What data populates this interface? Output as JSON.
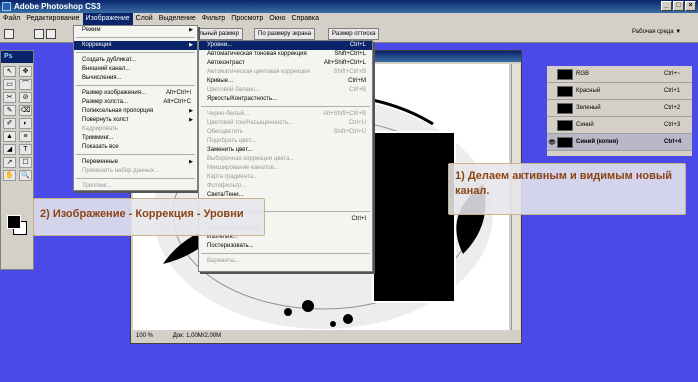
{
  "app": {
    "title": "Adobe Photoshop CS3"
  },
  "menubar": [
    "Файл",
    "Редактирование",
    "Изображение",
    "Слой",
    "Выделение",
    "Фильтр",
    "Просмотр",
    "Окно",
    "Справка"
  ],
  "options_bar": {
    "btn1": "Реальный размер",
    "btn2": "По размеру экрана",
    "btn3": "Размер оттиска",
    "workspace": "Рабочая среда"
  },
  "image_menu": [
    {
      "label": "Режим",
      "arrow": true
    },
    {
      "sep": true
    },
    {
      "label": "Коррекция",
      "arrow": true,
      "highlight": true
    },
    {
      "sep": true
    },
    {
      "label": "Создать дубликат..."
    },
    {
      "label": "Внешний канал..."
    },
    {
      "label": "Вычисления..."
    },
    {
      "sep": true
    },
    {
      "label": "Размер изображения...",
      "shortcut": "Alt+Ctrl+I"
    },
    {
      "label": "Размер холста...",
      "shortcut": "Alt+Ctrl+C"
    },
    {
      "label": "Попиксельная пропорция",
      "arrow": true
    },
    {
      "label": "Повернуть холст",
      "arrow": true
    },
    {
      "label": "Кадрировать",
      "disabled": true
    },
    {
      "label": "Тримминг..."
    },
    {
      "label": "Показать все"
    },
    {
      "sep": true
    },
    {
      "label": "Переменные",
      "arrow": true
    },
    {
      "label": "Применить набор данных...",
      "disabled": true
    },
    {
      "sep": true
    },
    {
      "label": "Треппинг...",
      "disabled": true
    }
  ],
  "adjust_menu": [
    {
      "label": "Уровни...",
      "shortcut": "Ctrl+L",
      "highlight": true
    },
    {
      "label": "Автоматическая тоновая коррекция",
      "shortcut": "Shift+Ctrl+L"
    },
    {
      "label": "Автоконтраст",
      "shortcut": "Alt+Shift+Ctrl+L"
    },
    {
      "label": "Автоматическая цветовая коррекция",
      "shortcut": "Shift+Ctrl+B",
      "disabled": true
    },
    {
      "label": "Кривые...",
      "shortcut": "Ctrl+M"
    },
    {
      "label": "Цветовой баланс...",
      "shortcut": "Ctrl+B",
      "disabled": true
    },
    {
      "label": "Яркость/Контрастность..."
    },
    {
      "sep": true
    },
    {
      "label": "Черно-белый...",
      "shortcut": "Alt+Shift+Ctrl+B",
      "disabled": true
    },
    {
      "label": "Цветовой тон/Насыщенность...",
      "shortcut": "Ctrl+U",
      "disabled": true
    },
    {
      "label": "Обесцветить",
      "shortcut": "Shift+Ctrl+U",
      "disabled": true
    },
    {
      "label": "Подобрать цвет...",
      "disabled": true
    },
    {
      "label": "Заменить цвет..."
    },
    {
      "label": "Выборочная коррекция цвета...",
      "disabled": true
    },
    {
      "label": "Микширование каналов...",
      "disabled": true
    },
    {
      "label": "Карта градиента...",
      "disabled": true
    },
    {
      "label": "Фотофильтр...",
      "disabled": true
    },
    {
      "label": "Света/Тени..."
    },
    {
      "label": "",
      "disabled": true
    },
    {
      "sep": true
    },
    {
      "label": "",
      "shortcut": "Ctrl+I"
    },
    {
      "label": "Выровнять яркость",
      "disabled": true
    },
    {
      "label": "Изогелия..."
    },
    {
      "label": "Постеризовать..."
    },
    {
      "sep": true
    },
    {
      "label": "Варианты...",
      "disabled": true
    }
  ],
  "layers": [
    {
      "name": "RGB",
      "shortcut": "Ctrl+~"
    },
    {
      "name": "Красный",
      "shortcut": "Ctrl+1"
    },
    {
      "name": "Зеленый",
      "shortcut": "Ctrl+2"
    },
    {
      "name": "Синий",
      "shortcut": "Ctrl+3"
    },
    {
      "name": "Синий (копия)",
      "shortcut": "Ctrl+4",
      "selected": true
    }
  ],
  "status": {
    "zoom": "100 %",
    "doc": "Док: 1,00M/2,00M"
  },
  "callouts": {
    "c1": "1) Делаем активным и видимым новый канал.",
    "c2": "2) Изображение - Коррекция - Уровни"
  }
}
